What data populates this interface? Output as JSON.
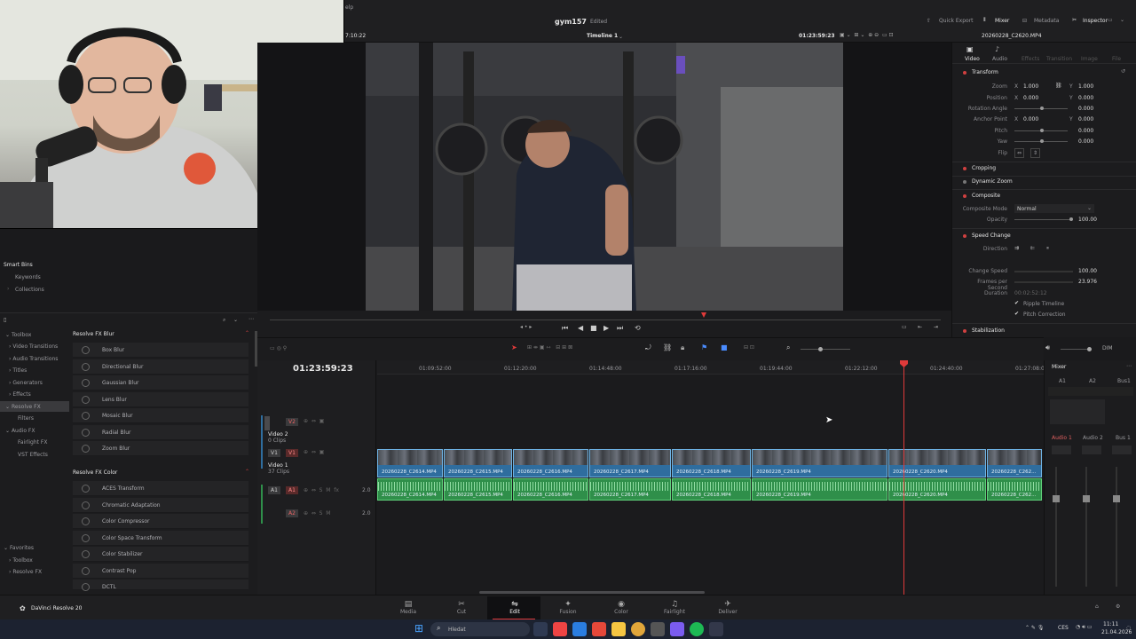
{
  "app": {
    "project_title": "gym157",
    "edited_status": "Edited",
    "timeline_name": "Timeline 1",
    "viewer_timecode": "01:23:59:23",
    "left_timecode_partial": "7:10:22",
    "clip_name": "20260228_C2620.MP4",
    "top_right": [
      "Quick Export",
      "Mixer",
      "Metadata",
      "Inspector"
    ],
    "help_fragment": "elp"
  },
  "media_pool": {
    "smart_bins_title": "Smart Bins",
    "smart_bins": [
      "Keywords",
      "Collections"
    ]
  },
  "effects": {
    "tree": [
      "Toolbox",
      "Video Transitions",
      "Audio Transitions",
      "Titles",
      "Generators",
      "Effects",
      "Resolve FX",
      "Filters",
      "Audio FX",
      "Fairlight FX",
      "VST Effects"
    ],
    "selected": "Resolve FX",
    "favorites_title": "Favorites",
    "favorites": [
      "Toolbox",
      "Resolve FX"
    ],
    "group1_title": "Resolve FX Blur",
    "group1": [
      "Box Blur",
      "Directional Blur",
      "Gaussian Blur",
      "Lens Blur",
      "Mosaic Blur",
      "Radial Blur",
      "Zoom Blur"
    ],
    "group2_title": "Resolve FX Color",
    "group2": [
      "ACES Transform",
      "Chromatic Adaptation",
      "Color Compressor",
      "Color Space Transform",
      "Color Stabilizer",
      "Contrast Pop",
      "DCTL"
    ]
  },
  "inspector": {
    "tabs": [
      "Video",
      "Audio",
      "Effects",
      "Transition",
      "Image",
      "File"
    ],
    "sections": [
      "Transform",
      "Cropping",
      "Dynamic Zoom",
      "Composite",
      "Speed Change",
      "Stabilization"
    ],
    "transform": {
      "zoom_label": "Zoom",
      "zoom_x": "1.000",
      "zoom_y": "1.000",
      "position_label": "Position",
      "position_x": "0.000",
      "position_y": "0.000",
      "rotation_label": "Rotation Angle",
      "rotation": "0.000",
      "anchor_label": "Anchor Point",
      "anchor_x": "0.000",
      "anchor_y": "0.000",
      "pitch_label": "Pitch",
      "pitch": "0.000",
      "yaw_label": "Yaw",
      "yaw": "0.000",
      "flip_label": "Flip",
      "x": "X",
      "y": "Y"
    },
    "composite": {
      "mode_label": "Composite Mode",
      "mode": "Normal",
      "opacity_label": "Opacity",
      "opacity": "100.00"
    },
    "speed": {
      "direction_label": "Direction",
      "change_speed_label": "Change Speed",
      "change_speed": "100.00",
      "fps_label": "Frames per Second",
      "fps": "23.976",
      "duration_label": "Duration",
      "duration": "00:02:52:12",
      "ripple": "Ripple Timeline",
      "pitch_correction": "Pitch Correction"
    }
  },
  "timeline": {
    "timecode": "01:23:59:23",
    "ruler": [
      "01:09:52:00",
      "01:12:20:00",
      "01:14:48:00",
      "01:17:16:00",
      "01:19:44:00",
      "01:22:12:00",
      "01:24:40:00",
      "01:27:08:00"
    ],
    "tracks": {
      "v2": "V2",
      "v2_name": "Video 2",
      "v2_clips": "0 Clips",
      "v1": "V1",
      "v1_name": "Video 1",
      "v1_clips": "37 Clips",
      "a1": "A1",
      "a1_level": "2.0",
      "a2": "A2",
      "a2_level": "2.0"
    },
    "clips": [
      "20260228_C2614.MP4",
      "20260228_C2615.MP4",
      "20260228_C2616.MP4",
      "20260228_C2617.MP4",
      "20260228_C2618.MP4",
      "20260228_C2619.MP4",
      "20260228_C2620.MP4",
      "20260228_C262..."
    ]
  },
  "mixer": {
    "title": "Mixer",
    "channels": [
      "A1",
      "A2",
      "Bus1"
    ],
    "strips": [
      "Audio 1",
      "Audio 2",
      "Bus 1"
    ],
    "dim": "DIM"
  },
  "pages": [
    "Media",
    "Cut",
    "Edit",
    "Fusion",
    "Color",
    "Fairlight",
    "Deliver"
  ],
  "active_page": "Edit",
  "app_name": "DaVinci Resolve 20",
  "taskbar": {
    "search": "Hledat",
    "lang": "CES",
    "time": "11:11",
    "date": "21.04.2026"
  },
  "colors": {
    "video_clip": "#2f6d9e",
    "audio_clip": "#2f8f4a",
    "playhead": "#e03a3a",
    "accent_red": "#d04040"
  }
}
